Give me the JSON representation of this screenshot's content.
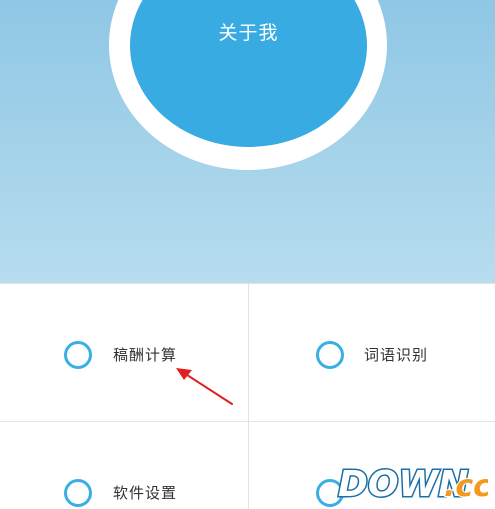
{
  "header": {
    "about_label": "关于我"
  },
  "menu": {
    "items": [
      {
        "label": "稿酬计算",
        "icon": "circle-outline-icon"
      },
      {
        "label": "词语识别",
        "icon": "circle-outline-icon"
      },
      {
        "label": "软件设置",
        "icon": "circle-outline-icon"
      },
      {
        "label": "",
        "icon": "circle-outline-icon"
      }
    ]
  },
  "annotation": {
    "arrow_color": "#e02020"
  },
  "watermark": {
    "text_main": "DOWN",
    "text_suffix": ".cc"
  },
  "colors": {
    "accent": "#3aaee6",
    "hero_gradient_top": "#8fc7e6",
    "hero_gradient_bottom": "#b7dcee"
  }
}
